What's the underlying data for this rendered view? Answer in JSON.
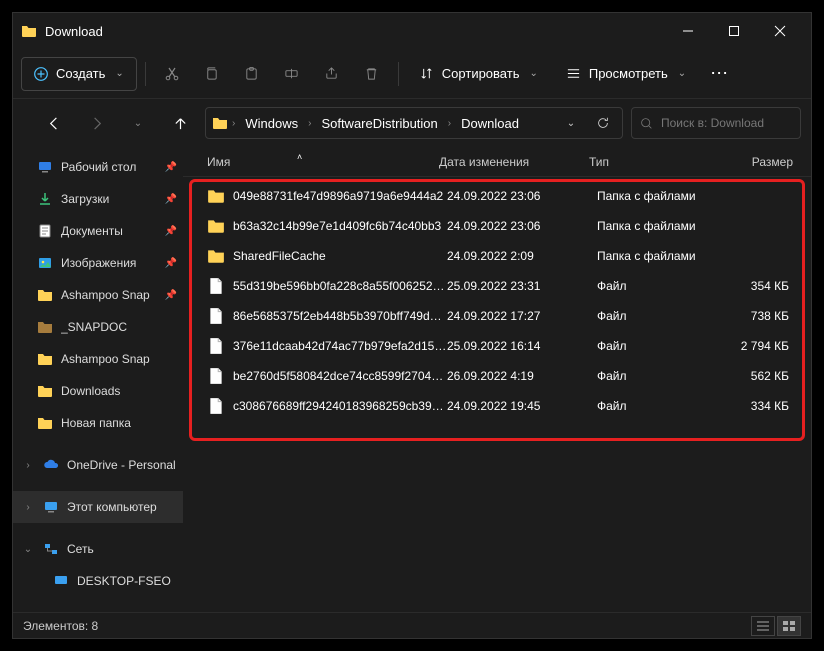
{
  "title": "Download",
  "toolbar": {
    "create_label": "Создать",
    "sort_label": "Сортировать",
    "view_label": "Просмотреть"
  },
  "breadcrumb": [
    "Windows",
    "SoftwareDistribution",
    "Download"
  ],
  "search": {
    "placeholder": "Поиск в: Download"
  },
  "sidebar": {
    "quick": [
      {
        "label": "Рабочий стол",
        "icon": "desktop",
        "pinned": true
      },
      {
        "label": "Загрузки",
        "icon": "download",
        "pinned": true
      },
      {
        "label": "Документы",
        "icon": "docs",
        "pinned": true
      },
      {
        "label": "Изображения",
        "icon": "pics",
        "pinned": true
      },
      {
        "label": "Ashampoo Snap",
        "icon": "folder",
        "pinned": true
      },
      {
        "label": "_SNAPDOC",
        "icon": "folder-dark",
        "pinned": false
      },
      {
        "label": "Ashampoo Snap",
        "icon": "folder",
        "pinned": false
      },
      {
        "label": "Downloads",
        "icon": "folder",
        "pinned": false
      },
      {
        "label": "Новая папка",
        "icon": "folder",
        "pinned": false
      }
    ],
    "onedrive_label": "OneDrive - Personal",
    "pc_label": "Этот компьютер",
    "network_label": "Сеть",
    "network_child": "DESKTOP-FSEO"
  },
  "columns": {
    "name": "Имя",
    "date": "Дата изменения",
    "type": "Тип",
    "size": "Размер"
  },
  "type_labels": {
    "folder": "Папка с файлами",
    "file": "Файл"
  },
  "size_unit": "КБ",
  "files": [
    {
      "name": "049e88731fe47d9896a9719a6e9444a2",
      "date": "24.09.2022 23:06",
      "type": "folder",
      "size": ""
    },
    {
      "name": "b63a32c14b99e7e1d409fc6b74c40bb3",
      "date": "24.09.2022 23:06",
      "type": "folder",
      "size": ""
    },
    {
      "name": "SharedFileCache",
      "date": "24.09.2022 2:09",
      "type": "folder",
      "size": ""
    },
    {
      "name": "55d319be596bb0fa228c8a55f006252eb8c5...",
      "date": "25.09.2022 23:31",
      "type": "file",
      "size": "354"
    },
    {
      "name": "86e5685375f2eb448b5b3970bff749d478cf...",
      "date": "24.09.2022 17:27",
      "type": "file",
      "size": "738"
    },
    {
      "name": "376e11dcaab42d74ac77b979efa2d15e818...",
      "date": "25.09.2022 16:14",
      "type": "file",
      "size": "2 794"
    },
    {
      "name": "be2760d5f580842dce74cc8599f2704254e6...",
      "date": "26.09.2022 4:19",
      "type": "file",
      "size": "562"
    },
    {
      "name": "c308676689ff294240183968259cb3933419...",
      "date": "24.09.2022 19:45",
      "type": "file",
      "size": "334"
    }
  ],
  "status": {
    "count_label": "Элементов:",
    "count": "8"
  }
}
